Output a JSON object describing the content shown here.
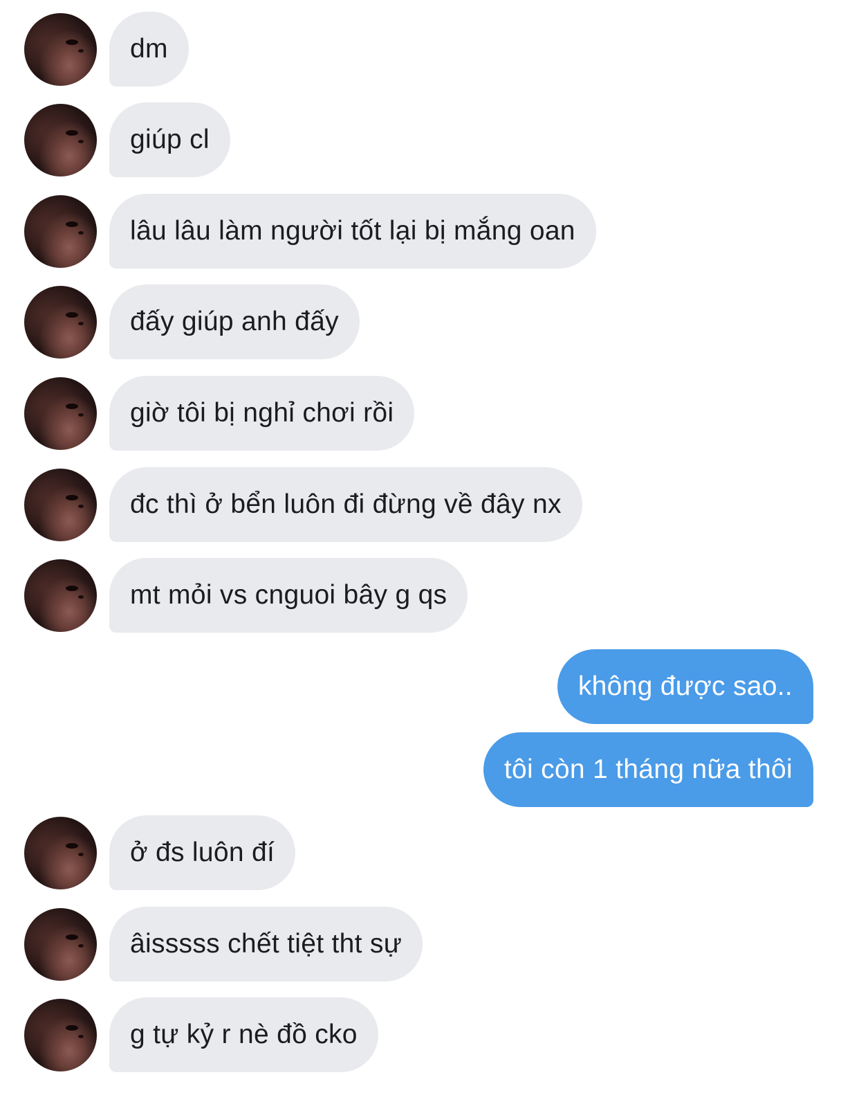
{
  "messages": [
    {
      "side": "in",
      "text": "dm"
    },
    {
      "side": "in",
      "text": "giúp cl"
    },
    {
      "side": "in",
      "text": "lâu lâu làm người tốt lại bị mắng oan"
    },
    {
      "side": "in",
      "text": "đấy giúp anh đấy"
    },
    {
      "side": "in",
      "text": "giờ tôi bị nghỉ chơi rồi"
    },
    {
      "side": "in",
      "text": "đc thì ở bển luôn đi đừng về đây nx"
    },
    {
      "side": "in",
      "text": "mt mỏi vs cnguoi bây g qs"
    },
    {
      "side": "out",
      "text": "không được sao.."
    },
    {
      "side": "out",
      "text": "tôi còn 1 tháng nữa thôi"
    },
    {
      "side": "in",
      "text": "ở đs luôn đí"
    },
    {
      "side": "in",
      "text": "âisssss chết tiệt tht sự"
    },
    {
      "side": "in",
      "text": "g tự kỷ r nè đồ cko"
    }
  ],
  "colors": {
    "incoming_bubble": "#e9eaee",
    "outgoing_bubble": "#4a9be8",
    "incoming_text": "#1c1c1e",
    "outgoing_text": "#ffffff"
  },
  "icons": {
    "avatar": "contact-avatar-photo"
  }
}
